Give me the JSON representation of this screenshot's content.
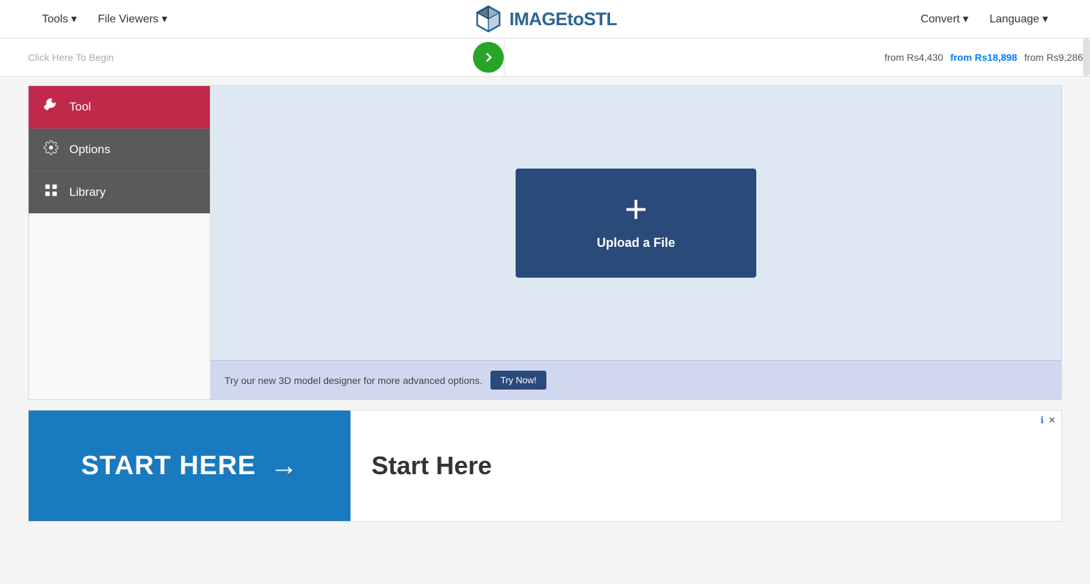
{
  "header": {
    "nav_left": [
      {
        "label": "Tools ▾",
        "id": "tools"
      },
      {
        "label": "File Viewers ▾",
        "id": "file-viewers"
      }
    ],
    "logo_text_main": "IMAGE",
    "logo_text_to": "to",
    "logo_text_end": "STL",
    "nav_right": [
      {
        "label": "Convert ▾",
        "id": "convert"
      },
      {
        "label": "Language ▾",
        "id": "language"
      }
    ]
  },
  "banner": {
    "click_text": "Click Here To Begin",
    "arrow_label": "→",
    "prices": [
      {
        "text": "from Rs4,430",
        "highlight": false
      },
      {
        "text": "from Rs18,898",
        "highlight": true
      },
      {
        "text": "from Rs9,286",
        "highlight": false
      }
    ]
  },
  "sidebar": {
    "tabs": [
      {
        "id": "tool",
        "label": "Tool",
        "icon": "wrench",
        "active": true
      },
      {
        "id": "options",
        "label": "Options",
        "icon": "gear"
      },
      {
        "id": "library",
        "label": "Library",
        "icon": "library"
      }
    ]
  },
  "workspace": {
    "upload_label": "Upload a File",
    "upload_plus": "+",
    "footer_text": "Try our new 3D model designer for more advanced options.",
    "try_now_label": "Try Now!"
  },
  "ad": {
    "start_btn_label": "START HERE",
    "start_arrow": "→",
    "right_title": "Start Here",
    "info_icon": "ℹ",
    "close_icon": "✕"
  }
}
